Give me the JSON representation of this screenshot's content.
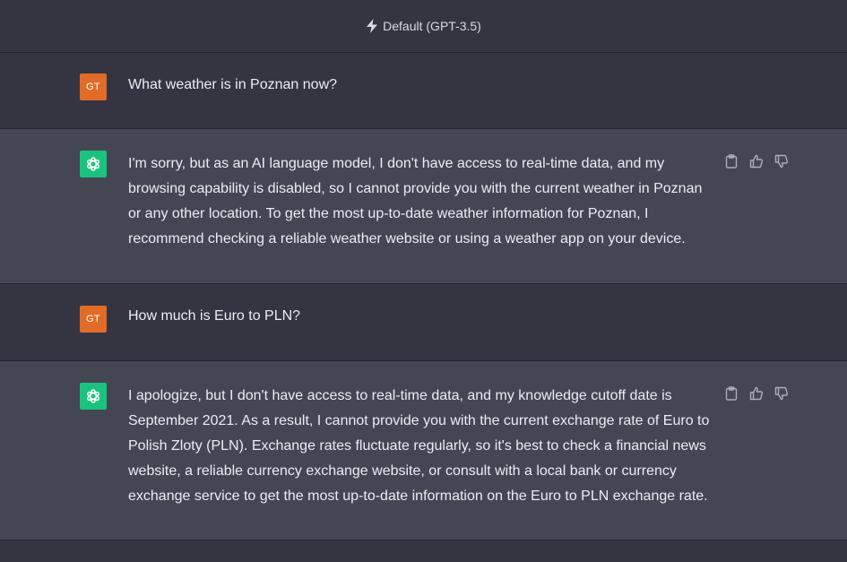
{
  "header": {
    "model_label": "Default (GPT-3.5)",
    "icon": "bolt-icon"
  },
  "conversation": [
    {
      "role": "user",
      "avatar_initials": "GT",
      "text": "What weather is in Poznan now?"
    },
    {
      "role": "assistant",
      "avatar_icon": "openai-logo-icon",
      "text": "I'm sorry, but as an AI language model, I don't have access to real-time data, and my browsing capability is disabled, so I cannot provide you with the current weather in Poznan or any other location. To get the most up-to-date weather information for Poznan, I recommend checking a reliable weather website or using a weather app on your device."
    },
    {
      "role": "user",
      "avatar_initials": "GT",
      "text": "How much is Euro to PLN?"
    },
    {
      "role": "assistant",
      "avatar_icon": "openai-logo-icon",
      "text": "I apologize, but I don't have access to real-time data, and my knowledge cutoff date is September 2021. As a result, I cannot provide you with the current exchange rate of Euro to Polish Zloty (PLN). Exchange rates fluctuate regularly, so it's best to check a financial news website, a reliable currency exchange website, or consult with a local bank or currency exchange service to get the most up-to-date information on the Euro to PLN exchange rate."
    }
  ],
  "colors": {
    "background": "#343541",
    "assistant_row": "#444654",
    "user_avatar": "#e06c28",
    "assistant_avatar": "#19c37d",
    "text": "#ececf1",
    "icon": "#acacbe"
  }
}
